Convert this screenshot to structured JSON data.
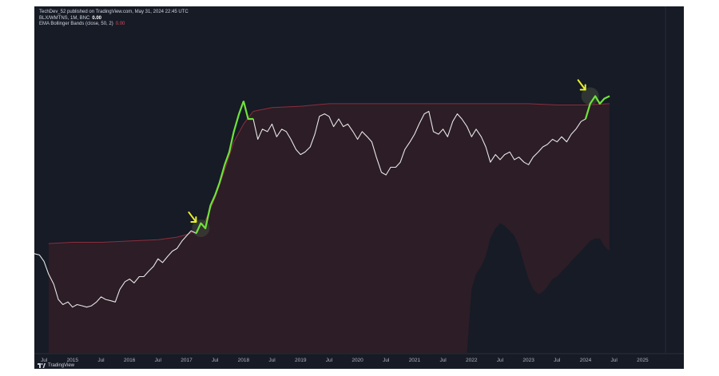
{
  "header": {
    "published": "TechDev_52 published on TradingView.com, May 31, 2024 22:45 UTC",
    "symbol": "BLX/WMTNS, 1M, BNC",
    "symbol_value": "0.00",
    "indicator": "EMA Bollinger Bands (close, 50, 2)",
    "indicator_value": "0.00"
  },
  "footer": {
    "brand": "TradingView"
  },
  "colors": {
    "background": "#161b26",
    "price_line": "#e6e6e6",
    "highlight": "#6fe33a",
    "band": "#8c2e3c",
    "band_fill": "#2c1d26",
    "arrow": "#e8f02a"
  },
  "chart_data": {
    "type": "line",
    "title": "",
    "x_axis_ticks": [
      "Jul",
      "2015",
      "Jul",
      "2016",
      "Jul",
      "2017",
      "Jul",
      "2018",
      "Jul",
      "2019",
      "Jul",
      "2020",
      "Jul",
      "2021",
      "Jul",
      "2022",
      "Jul",
      "2023",
      "Jul",
      "2024",
      "Jul",
      "2025"
    ],
    "x_tick_dates": [
      2014.5,
      2015,
      2015.5,
      2016,
      2016.5,
      2017,
      2017.5,
      2018,
      2018.5,
      2019,
      2019.5,
      2020,
      2020.5,
      2021,
      2021.5,
      2022,
      2022.5,
      2023,
      2023.5,
      2024,
      2024.5,
      2025
    ],
    "x_range": [
      2014.33,
      2025.71
    ],
    "y_range": [
      -0.5,
      12.5
    ],
    "series": [
      {
        "role": "price",
        "x": [
          2014.33,
          2014.42,
          2014.5,
          2014.58,
          2014.67,
          2014.75,
          2014.83,
          2014.92,
          2015.0,
          2015.08,
          2015.17,
          2015.25,
          2015.33,
          2015.42,
          2015.5,
          2015.58,
          2015.67,
          2015.75,
          2015.83,
          2015.92,
          2016.0,
          2016.08,
          2016.17,
          2016.25,
          2016.33,
          2016.42,
          2016.5,
          2016.58,
          2016.67,
          2016.75,
          2016.83,
          2016.92,
          2017.0,
          2017.08,
          2017.17,
          2017.25,
          2017.33,
          2017.42,
          2017.5,
          2017.58,
          2017.67,
          2017.75,
          2017.83,
          2017.92,
          2018.0,
          2018.08,
          2018.17,
          2018.25,
          2018.33,
          2018.42,
          2018.5,
          2018.58,
          2018.67,
          2018.75,
          2018.83,
          2018.92,
          2019.0,
          2019.08,
          2019.17,
          2019.25,
          2019.33,
          2019.42,
          2019.5,
          2019.58,
          2019.67,
          2019.75,
          2019.83,
          2019.92,
          2020.0,
          2020.08,
          2020.17,
          2020.25,
          2020.33,
          2020.42,
          2020.5,
          2020.58,
          2020.67,
          2020.75,
          2020.83,
          2020.92,
          2021.0,
          2021.08,
          2021.17,
          2021.25,
          2021.33,
          2021.42,
          2021.5,
          2021.58,
          2021.67,
          2021.75,
          2021.83,
          2021.92,
          2022.0,
          2022.08,
          2022.17,
          2022.25,
          2022.33,
          2022.42,
          2022.5,
          2022.58,
          2022.67,
          2022.75,
          2022.83,
          2022.92,
          2023.0,
          2023.08,
          2023.17,
          2023.25,
          2023.33,
          2023.42,
          2023.5,
          2023.58,
          2023.67,
          2023.75,
          2023.83,
          2023.92,
          2024.0,
          2024.08,
          2024.17,
          2024.25,
          2024.33,
          2024.42
        ],
        "y": [
          3.4,
          3.35,
          3.1,
          2.6,
          2.2,
          1.6,
          1.4,
          1.5,
          1.3,
          1.4,
          1.35,
          1.3,
          1.35,
          1.5,
          1.7,
          1.6,
          1.55,
          1.5,
          2.0,
          2.3,
          2.4,
          2.25,
          2.5,
          2.5,
          2.7,
          2.9,
          3.2,
          3.05,
          3.3,
          3.5,
          3.6,
          3.9,
          4.1,
          4.3,
          4.2,
          4.6,
          4.4,
          5.3,
          5.7,
          6.2,
          6.9,
          7.4,
          8.2,
          8.9,
          9.4,
          8.7,
          8.7,
          7.9,
          8.3,
          8.2,
          8.5,
          8.0,
          8.3,
          8.2,
          7.9,
          7.5,
          7.3,
          7.4,
          7.6,
          8.1,
          8.8,
          8.9,
          8.8,
          8.4,
          8.7,
          8.4,
          8.5,
          8.2,
          7.9,
          8.2,
          8.0,
          7.8,
          7.2,
          6.6,
          6.5,
          6.8,
          6.8,
          7.0,
          7.5,
          7.8,
          8.1,
          8.5,
          8.9,
          9.0,
          8.2,
          8.1,
          8.3,
          8.0,
          8.6,
          8.9,
          8.7,
          8.4,
          8.0,
          8.3,
          8.0,
          7.6,
          7.0,
          7.3,
          7.1,
          7.3,
          7.4,
          7.1,
          7.2,
          7.0,
          6.9,
          7.2,
          7.4,
          7.6,
          7.7,
          7.9,
          7.8,
          8.0,
          7.8,
          8.1,
          8.3,
          8.6,
          8.7,
          9.3,
          9.6,
          9.3,
          9.5,
          9.6
        ]
      },
      {
        "role": "upper-band",
        "x": [
          2014.58,
          2015.0,
          2015.5,
          2016.0,
          2016.5,
          2016.83,
          2017.0,
          2017.17,
          2017.33,
          2017.5,
          2017.67,
          2017.83,
          2018.0,
          2018.17,
          2018.5,
          2019.0,
          2019.5,
          2020.0,
          2020.5,
          2021.0,
          2021.5,
          2022.0,
          2022.5,
          2023.0,
          2023.5,
          2024.0,
          2024.42
        ],
        "y": [
          3.8,
          3.85,
          3.85,
          3.9,
          3.95,
          4.05,
          4.15,
          4.3,
          4.7,
          5.6,
          6.7,
          7.8,
          8.5,
          9.0,
          9.15,
          9.2,
          9.3,
          9.3,
          9.3,
          9.3,
          9.3,
          9.3,
          9.3,
          9.3,
          9.25,
          9.25,
          9.3
        ]
      },
      {
        "role": "lower-band",
        "x": [
          2021.92,
          2022.0,
          2022.08,
          2022.17,
          2022.25,
          2022.33,
          2022.42,
          2022.5,
          2022.58,
          2022.67,
          2022.75,
          2022.83,
          2022.92,
          2023.0,
          2023.08,
          2023.17,
          2023.25,
          2023.33,
          2023.42,
          2023.5,
          2023.58,
          2023.67,
          2023.75,
          2023.83,
          2023.92,
          2024.0,
          2024.08,
          2024.17,
          2024.25,
          2024.33,
          2024.42
        ],
        "y": [
          -0.5,
          2.0,
          2.6,
          2.9,
          3.3,
          4.0,
          4.4,
          4.6,
          4.5,
          4.3,
          4.1,
          3.7,
          3.0,
          2.4,
          2.0,
          1.8,
          1.9,
          2.1,
          2.4,
          2.5,
          2.7,
          2.9,
          3.1,
          3.3,
          3.5,
          3.7,
          3.9,
          4.0,
          4.0,
          3.7,
          3.5
        ]
      }
    ],
    "highlighted_segments": [
      {
        "from_x": 2017.17,
        "to_x": 2018.0
      },
      {
        "from_x": 2018.0,
        "to_x": 2018.17
      },
      {
        "from_x": 2024.0,
        "to_x": 2024.42
      }
    ],
    "annotations": [
      {
        "kind": "arrow",
        "x": 2017.25,
        "y": 4.4
      },
      {
        "kind": "arrow",
        "x": 2024.08,
        "y": 9.6
      }
    ]
  }
}
